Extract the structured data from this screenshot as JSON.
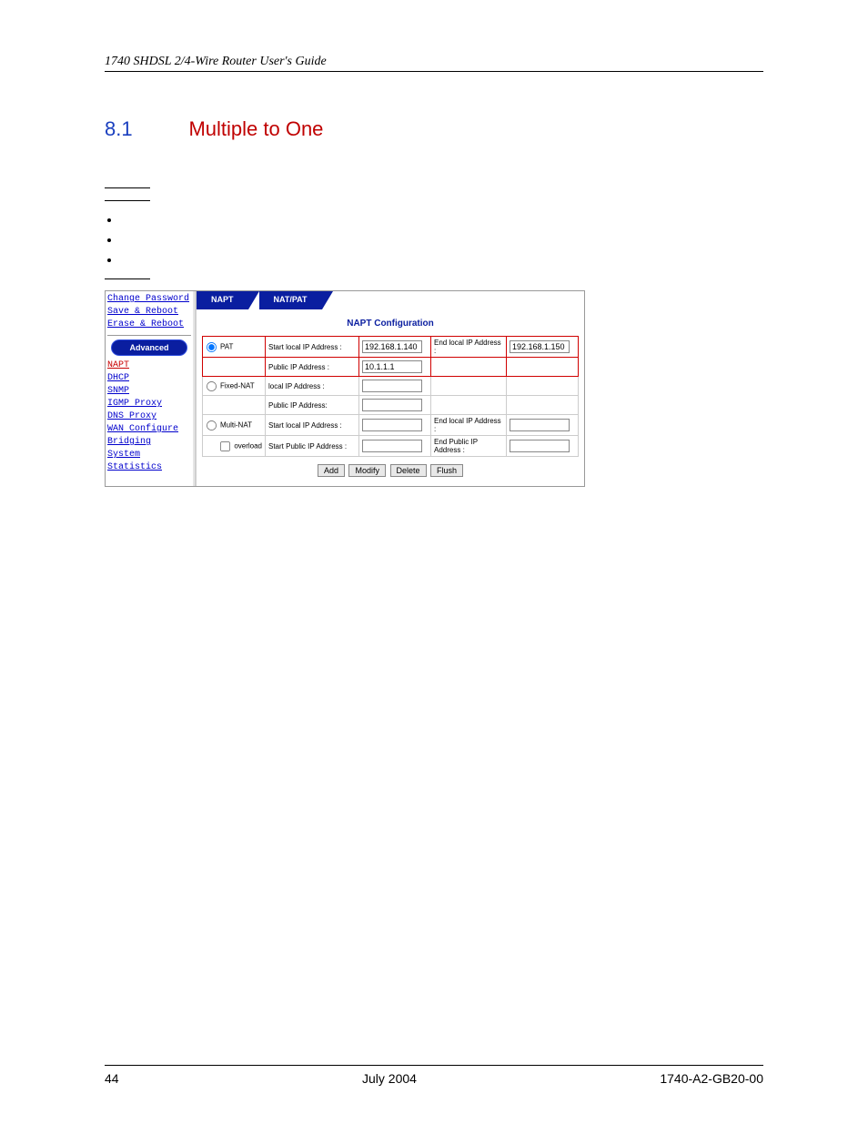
{
  "header": "1740 SHDSL 2/4-Wire Router User's Guide",
  "section": {
    "num": "8.1",
    "title": "Multiple to One"
  },
  "sidebar": {
    "top": [
      "Change Password",
      "Save & Reboot",
      "Erase & Reboot"
    ],
    "adv_label": "Advanced",
    "links": [
      "NAPT",
      "DHCP",
      "SNMP",
      "IGMP Proxy",
      "DNS Proxy",
      "WAN Configure",
      "Bridging",
      "System Statistics"
    ]
  },
  "tabs": {
    "t1": "NAPT",
    "t2": "NAT/PAT"
  },
  "config_title": "NAPT Configuration",
  "rows": {
    "pat": {
      "radio": "PAT",
      "l1": "Start local IP Address :",
      "v1": "192.168.1.140",
      "l2": "End local IP Address :",
      "v2": "192.168.1.150",
      "l3": "Public IP Address :",
      "v3": "10.1.1.1"
    },
    "fixed": {
      "radio": "Fixed-NAT",
      "l1": "local IP Address :",
      "l2": "Public IP Address:"
    },
    "multi": {
      "radio": "Multi-NAT",
      "l1": "Start local IP Address :",
      "l2": "End local IP Address :",
      "chk": "overload",
      "l3": "Start Public IP Address :",
      "l4": "End Public IP Address :"
    }
  },
  "buttons": {
    "add": "Add",
    "modify": "Modify",
    "delete": "Delete",
    "flush": "Flush"
  },
  "footer": {
    "left": "44",
    "center": "July 2004",
    "right": "1740-A2-GB20-00"
  }
}
